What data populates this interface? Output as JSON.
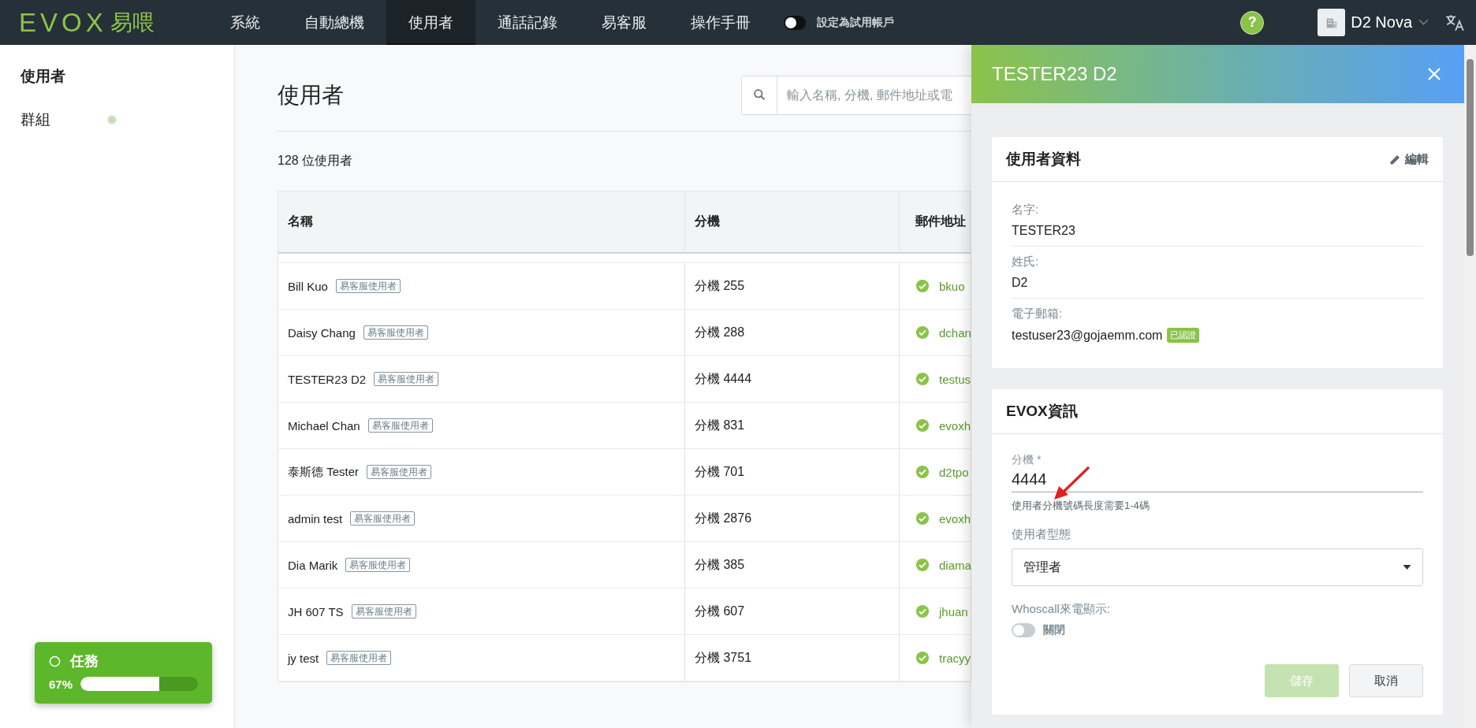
{
  "top_bar": {
    "logo": {
      "mark": "EVOX",
      "text": "易喂"
    },
    "nav": [
      {
        "label": "系統",
        "selected": false
      },
      {
        "label": "自動總機",
        "selected": false
      },
      {
        "label": "使用者",
        "selected": true
      },
      {
        "label": "通話記錄",
        "selected": false
      },
      {
        "label": "易客服",
        "selected": false
      },
      {
        "label": "操作手冊",
        "selected": false
      }
    ],
    "trial_toggle": {
      "label": "設定為試用帳戶",
      "on": false
    },
    "help": "?",
    "account": {
      "name": "D2 Nova"
    }
  },
  "sidebar": {
    "items": [
      {
        "label": "使用者",
        "selected": true
      },
      {
        "label": "群組",
        "selected": false
      }
    ]
  },
  "task_widget": {
    "title": "任務",
    "percent": "67%",
    "level": 0.67
  },
  "page": {
    "title": "使用者",
    "search": {
      "placeholder": "輸入名稱, 分機, 郵件地址或電"
    },
    "count": "128 位使用者"
  },
  "table": {
    "columns": [
      "名稱",
      "分機",
      "郵件地址"
    ],
    "rows": [
      {
        "name": "Bill Kuo",
        "tag": "易客服使用者",
        "extension": "分機 255",
        "email": "bkuo",
        "verified": true
      },
      {
        "name": "Daisy Chang",
        "tag": "易客服使用者",
        "extension": "分機 288",
        "email": "dchan",
        "verified": true
      },
      {
        "name": "TESTER23 D2",
        "tag": "易客服使用者",
        "extension": "分機 4444",
        "email": "testus",
        "verified": true
      },
      {
        "name": "Michael Chan",
        "tag": "易客服使用者",
        "extension": "分機 831",
        "email": "evoxh",
        "verified": true
      },
      {
        "name": "泰斯德 Tester",
        "tag": "易客服使用者",
        "extension": "分機 701",
        "email": "d2tpo",
        "verified": true
      },
      {
        "name": "admin test",
        "tag": "易客服使用者",
        "extension": "分機 2876",
        "email": "evoxh",
        "verified": true
      },
      {
        "name": "Dia Marik",
        "tag": "易客服使用者",
        "extension": "分機 385",
        "email": "diama",
        "verified": true
      },
      {
        "name": "JH 607 TS",
        "tag": "易客服使用者",
        "extension": "分機 607",
        "email": "jhuan",
        "verified": true
      },
      {
        "name": "jy test",
        "tag": "易客服使用者",
        "extension": "分機 3751",
        "email": "tracyy",
        "verified": true
      }
    ]
  },
  "drawer": {
    "title": "TESTER23 D2",
    "profile": {
      "title": "使用者資料",
      "edit": "編輯",
      "fields": [
        {
          "label": "名字:",
          "value": "TESTER23"
        },
        {
          "label": "姓氏:",
          "value": "D2"
        },
        {
          "label": "電子郵箱:",
          "value": "testuser23@gojaemm.com",
          "badge": "已認證"
        }
      ]
    },
    "evox": {
      "title": "EVOX資訊",
      "extension": {
        "label": "分機 *",
        "value": "4444",
        "hint": "使用者分機號碼長度需要1-4碼"
      },
      "user_type": {
        "label": "使用者型態",
        "value": "管理者"
      },
      "whoscall": {
        "label": "Whoscall來電顯示:",
        "on": false,
        "state_label": "關閉"
      },
      "buttons": [
        {
          "label": "儲存",
          "disabled": true
        },
        {
          "label": "取消",
          "disabled": false
        }
      ]
    }
  }
}
